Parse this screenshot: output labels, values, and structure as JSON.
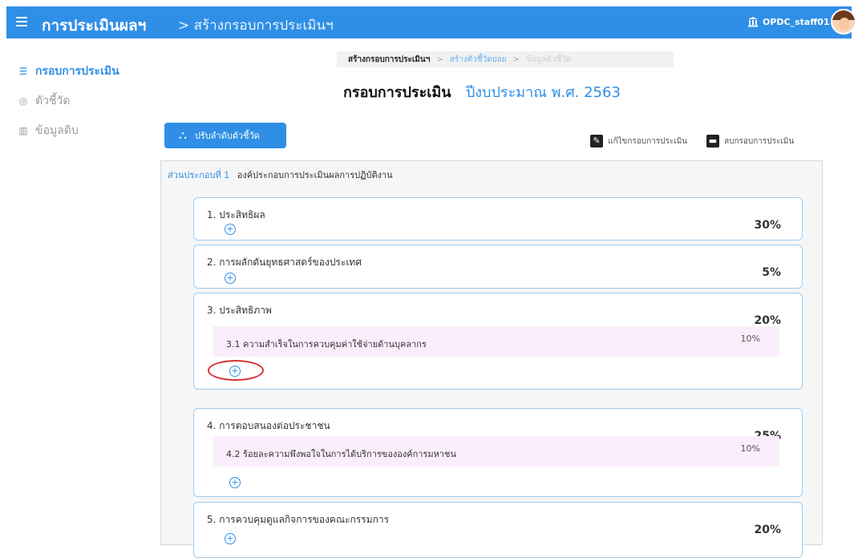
{
  "header": {
    "app_title": "การประเมินผลฯ",
    "breadcrumb": "> สร้างกรอบการประเมินฯ",
    "user": "OPDC_staff01"
  },
  "sidebar": {
    "items": [
      {
        "label": "กรอบการประเมิน",
        "icon": "list-icon",
        "active": true
      },
      {
        "label": "ตัวชี้วัด",
        "icon": "target-icon",
        "active": false
      },
      {
        "label": "ข้อมูลดิบ",
        "icon": "chart-icon",
        "active": false
      }
    ]
  },
  "steps": [
    "สร้างกรอบการประเมินฯ",
    "สร้างตัวชี้วัดย่อย",
    "ข้อมูลตัวชี้วัด"
  ],
  "page": {
    "title": "กรอบการประเมิน",
    "year": "ปีงบประมาณ พ.ศ. 2563"
  },
  "toolbar": {
    "order_button": "ปรับลำดับตัวชี้วัด",
    "edit_label": "แก้ไขกรอบการประเมิน",
    "delete_label": "ลบกรอบการประเมิน"
  },
  "component": {
    "label": "ส่วนประกอบที่ 1",
    "title": "องค์ประกอบการประเมินผลการปฏิบัติงาน"
  },
  "cards": [
    {
      "title": "1. ประสิทธิผล",
      "percent": "30%",
      "subs": []
    },
    {
      "title": "2. การผลักดันยุทธศาสตร์ของประเทศ",
      "percent": "5%",
      "subs": []
    },
    {
      "title": "3. ประสิทธิภาพ",
      "percent": "20%",
      "subs": [
        {
          "title": "3.1 ความสำเร็จในการควบคุมค่าใช้จ่ายด้านบุคลากร",
          "percent": "10%"
        }
      ]
    },
    {
      "title": "4. การตอบสนองต่อประชาชน",
      "percent": "25%",
      "subs": [
        {
          "title": "4.2 ร้อยละความพึงพอใจในการได้บริการขององค์การมหาชน",
          "percent": "10%"
        }
      ]
    },
    {
      "title": "5. การควบคุมดูแลกิจการของคณะกรรมการ",
      "percent": "20%",
      "subs": []
    }
  ],
  "add_symbol": "+",
  "colors": {
    "primary": "#2f8fe6",
    "highlight": "#d93232",
    "sub_row_bg": "#fbeefc"
  }
}
